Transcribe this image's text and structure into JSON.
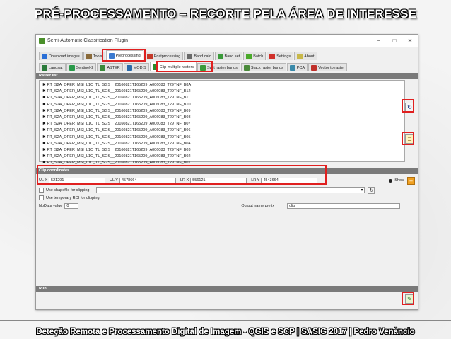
{
  "slide": {
    "title": "PRÉ-PROCESSAMENTO – RECORTE PELA ÁREA DE INTERESSE",
    "footer": "Deteção Remota e Processamento Digital de Imagem - QGIS e SCP   |   SASIG 2017   |   Pedro Venâncio"
  },
  "window": {
    "title": "Semi-Automatic Classification Plugin",
    "minimize": "−",
    "maximize": "□",
    "close": "✕"
  },
  "main_tabs": [
    {
      "label": "Download images"
    },
    {
      "label": "Tools"
    },
    {
      "label": "Preprocessing"
    },
    {
      "label": "Postprocessing"
    },
    {
      "label": "Band calc"
    },
    {
      "label": "Band set"
    },
    {
      "label": "Batch"
    },
    {
      "label": "Settings"
    },
    {
      "label": "About"
    }
  ],
  "sub_tabs": [
    {
      "label": "Landsat"
    },
    {
      "label": "Sentinel-2"
    },
    {
      "label": "ASTER"
    },
    {
      "label": "MODIS"
    },
    {
      "label": "Clip multiple rasters"
    },
    {
      "label": "Split raster bands"
    },
    {
      "label": "Stack raster bands"
    },
    {
      "label": "PCA"
    },
    {
      "label": "Vector to raster"
    }
  ],
  "raster_list": {
    "header": "Raster list",
    "items": [
      "RT_S2A_OPER_MSI_L1C_TL_SGS__20160821T165209_A006083_T29TNF_B8A",
      "RT_S2A_OPER_MSI_L1C_TL_SGS__20160821T165209_A006083_T29TNF_B12",
      "RT_S2A_OPER_MSI_L1C_TL_SGS__20160821T165209_A006083_T29TNF_B11",
      "RT_S2A_OPER_MSI_L1C_TL_SGS__20160821T165209_A006083_T29TNF_B10",
      "RT_S2A_OPER_MSI_L1C_TL_SGS__20160821T165209_A006083_T29TNF_B09",
      "RT_S2A_OPER_MSI_L1C_TL_SGS__20160821T165209_A006083_T29TNF_B08",
      "RT_S2A_OPER_MSI_L1C_TL_SGS__20160821T165209_A006083_T29TNF_B07",
      "RT_S2A_OPER_MSI_L1C_TL_SGS__20160821T165209_A006083_T29TNF_B06",
      "RT_S2A_OPER_MSI_L1C_TL_SGS__20160821T165209_A006083_T29TNF_B05",
      "RT_S2A_OPER_MSI_L1C_TL_SGS__20160821T165209_A006083_T29TNF_B04",
      "RT_S2A_OPER_MSI_L1C_TL_SGS__20160821T165209_A006083_T29TNF_B03",
      "RT_S2A_OPER_MSI_L1C_TL_SGS__20160821T165209_A006083_T29TNF_B02",
      "RT_S2A_OPER_MSI_L1C_TL_SGS__20160821T165209_A006083_T29TNF_B01"
    ]
  },
  "clip": {
    "header": "Clip coordinates",
    "ulx_label": "UL X",
    "ulx": "521291",
    "uly_label": "UL Y",
    "uly": "4578664",
    "lrx_label": "LR X",
    "lrx": "556121",
    "lry_label": "LR Y",
    "lry": "4543664",
    "show_label": "Show"
  },
  "options": {
    "use_shapefile": "Use shapefile for clipping",
    "use_temp_roi": "Use temporary ROI for clipping",
    "nodata_label": "NoData value",
    "nodata_value": "0",
    "output_prefix_label": "Output name prefix",
    "output_prefix": "clip"
  },
  "run": {
    "header": "Run"
  },
  "colors": {
    "highlight": "#e02020",
    "section_header": "#7a7a7a"
  }
}
